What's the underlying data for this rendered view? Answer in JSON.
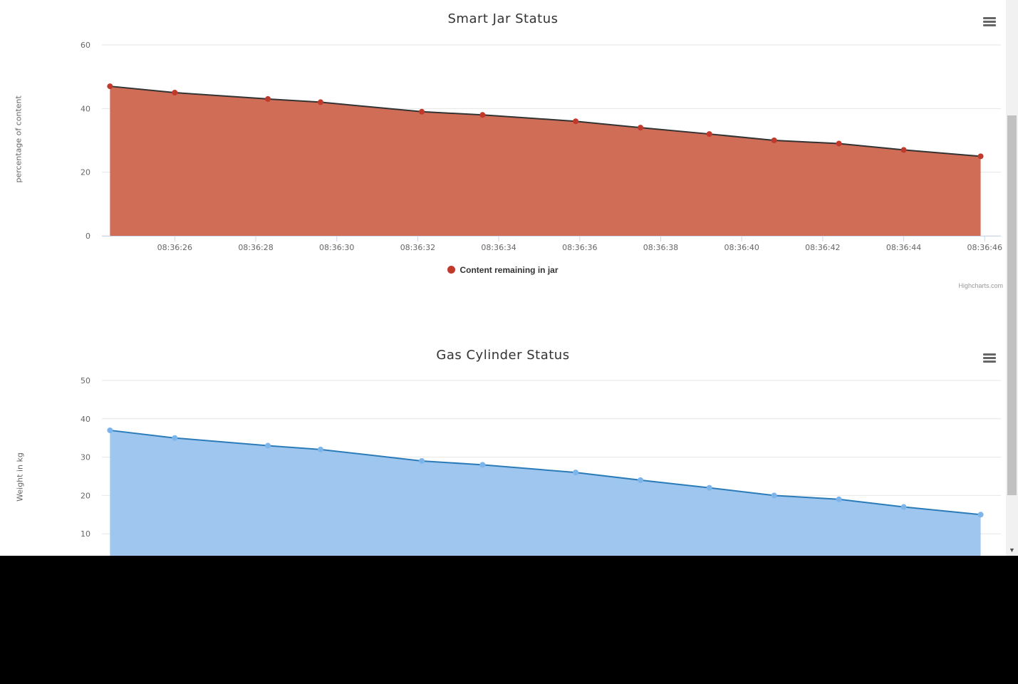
{
  "colors": {
    "jar_fill": "#d06d57",
    "jar_line": "#333333",
    "jar_marker": "#c0392b",
    "gas_fill": "#9ec6ef",
    "gas_line": "#2b7bb9",
    "gas_marker": "#7cb5ec",
    "grid": "#e6e6e6"
  },
  "jar": {
    "title": "Smart Jar Status",
    "ylabel": "percentage of content",
    "legend": "Content remaining in jar",
    "credits": "Highcharts.com",
    "menu_icon": "hamburger-menu-icon"
  },
  "gas": {
    "title": "Gas Cylinder Status",
    "ylabel": "Weight in kg",
    "menu_icon": "hamburger-menu-icon"
  },
  "scrollbar": {
    "down_arrow": "▼"
  },
  "chart_data": [
    {
      "type": "area",
      "title": "Smart Jar Status",
      "ylabel": "percentage of content",
      "xlabel": "",
      "ylim": [
        0,
        60
      ],
      "yticks": [
        0,
        20,
        40,
        60
      ],
      "xlim": [
        "08:36:24.2",
        "08:36:46.4"
      ],
      "xticks": [
        "08:36:26",
        "08:36:28",
        "08:36:30",
        "08:36:32",
        "08:36:34",
        "08:36:36",
        "08:36:38",
        "08:36:40",
        "08:36:42",
        "08:36:44",
        "08:36:46"
      ],
      "x": [
        "08:36:24.4",
        "08:36:26.0",
        "08:36:28.3",
        "08:36:29.6",
        "08:36:32.1",
        "08:36:33.6",
        "08:36:35.9",
        "08:36:37.5",
        "08:36:39.2",
        "08:36:40.8",
        "08:36:42.4",
        "08:36:44.0",
        "08:36:45.9"
      ],
      "series": [
        {
          "name": "Content remaining in jar",
          "values": [
            47,
            45,
            43,
            42,
            39,
            38,
            36,
            34,
            32,
            30,
            29,
            27,
            25
          ]
        }
      ],
      "legend": "bottom-center",
      "grid": true
    },
    {
      "type": "area",
      "title": "Gas Cylinder Status",
      "ylabel": "Weight in kg",
      "xlabel": "",
      "ylim": [
        0,
        50
      ],
      "yticks": [
        10,
        20,
        30,
        40,
        50
      ],
      "xlim": [
        "08:36:24.2",
        "08:36:46.4"
      ],
      "x": [
        "08:36:24.4",
        "08:36:26.0",
        "08:36:28.3",
        "08:36:29.6",
        "08:36:32.1",
        "08:36:33.6",
        "08:36:35.9",
        "08:36:37.5",
        "08:36:39.2",
        "08:36:40.8",
        "08:36:42.4",
        "08:36:44.0",
        "08:36:45.9"
      ],
      "series": [
        {
          "values": [
            37,
            35,
            33,
            32,
            29,
            28,
            26,
            24,
            22,
            20,
            19,
            17,
            15
          ]
        }
      ],
      "grid": true
    }
  ]
}
